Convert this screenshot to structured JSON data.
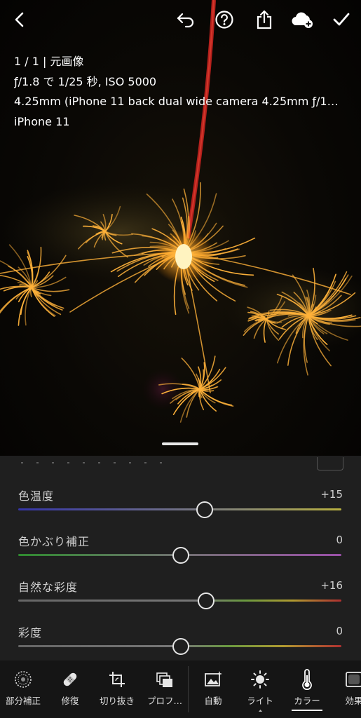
{
  "info": {
    "line1": "1 / 1 | 元画像",
    "line2": "ƒ/1.8 で 1/25 秒, ISO 5000",
    "line3": "4.25mm (iPhone 11 back dual wide camera 4.25mm ƒ/1…",
    "line4": "iPhone 11"
  },
  "sliders": [
    {
      "label": "色温度",
      "value": "+15",
      "level": 0.575
    },
    {
      "label": "色かぶり補正",
      "value": "0",
      "level": 0.5
    },
    {
      "label": "自然な彩度",
      "value": "+16",
      "level": 0.58
    },
    {
      "label": "彩度",
      "value": "0",
      "level": 0.5
    }
  ],
  "tools": [
    {
      "label": "部分補正",
      "icon": "selective-icon"
    },
    {
      "label": "修復",
      "icon": "bandage-icon"
    },
    {
      "label": "切り抜き",
      "icon": "crop-icon"
    },
    {
      "label": "プロフ…",
      "icon": "profile-icon"
    },
    {
      "label": "自動",
      "icon": "auto-icon"
    },
    {
      "label": "ライト",
      "icon": "sun-icon"
    },
    {
      "label": "カラー",
      "icon": "thermometer-icon",
      "active": true
    },
    {
      "label": "効果",
      "icon": "effects-icon"
    }
  ],
  "colors": {
    "accent": "#ffffff",
    "panel": "#1f1f1f",
    "toolbar": "#151515"
  }
}
